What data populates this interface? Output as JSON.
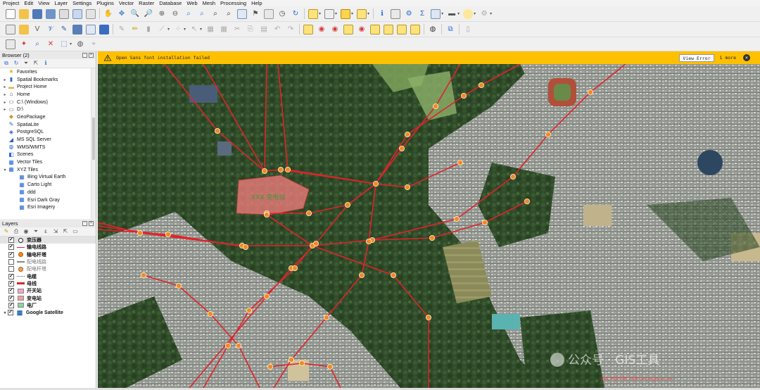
{
  "menu": [
    "Project",
    "Edit",
    "View",
    "Layer",
    "Settings",
    "Plugins",
    "Vector",
    "Raster",
    "Database",
    "Web",
    "Mesh",
    "Processing",
    "Help"
  ],
  "browser": {
    "title": "Browser (2)",
    "items": [
      {
        "label": "Favorites",
        "icon": "star-icon",
        "arrow": ""
      },
      {
        "label": "Spatial Bookmarks",
        "icon": "bookmark-icon",
        "arrow": "▸"
      },
      {
        "label": "Project Home",
        "icon": "folder-icon",
        "arrow": "▸"
      },
      {
        "label": "Home",
        "icon": "home-icon",
        "arrow": "▸"
      },
      {
        "label": "C:\\ (Windows)",
        "icon": "drive-icon",
        "arrow": "▸"
      },
      {
        "label": "D:\\",
        "icon": "drive-icon",
        "arrow": "▸"
      },
      {
        "label": "GeoPackage",
        "icon": "geopackage-icon",
        "arrow": ""
      },
      {
        "label": "SpatiaLite",
        "icon": "spatialite-icon",
        "arrow": ""
      },
      {
        "label": "PostgreSQL",
        "icon": "postgresql-icon",
        "arrow": ""
      },
      {
        "label": "MS SQL Server",
        "icon": "mssql-icon",
        "arrow": ""
      },
      {
        "label": "WMS/WMTS",
        "icon": "wms-icon",
        "arrow": ""
      },
      {
        "label": "Scenes",
        "icon": "scenes-icon",
        "arrow": ""
      },
      {
        "label": "Vector Tiles",
        "icon": "vector-tiles-icon",
        "arrow": ""
      },
      {
        "label": "XYZ Tiles",
        "icon": "xyz-tiles-icon",
        "arrow": "▾"
      },
      {
        "label": "Bing Virtual Earth",
        "icon": "grid-icon",
        "arrow": "",
        "indent": 1
      },
      {
        "label": "Carto Light",
        "icon": "grid-icon",
        "arrow": "",
        "indent": 1
      },
      {
        "label": "ddd",
        "icon": "grid-icon",
        "arrow": "",
        "indent": 1
      },
      {
        "label": "Esri Dark Gray",
        "icon": "grid-icon",
        "arrow": "",
        "indent": 1
      },
      {
        "label": "Esri Imagery",
        "icon": "grid-icon",
        "arrow": "",
        "indent": 1
      }
    ]
  },
  "layers": {
    "title": "Layers",
    "items": [
      {
        "label": "变压器",
        "checked": true,
        "symbol": "circle",
        "color": "#ffffff",
        "bold": true,
        "selected": true
      },
      {
        "label": "输电线路",
        "checked": true,
        "symbol": "line",
        "color": "#e0232a",
        "bold": true
      },
      {
        "label": "输电杆塔",
        "checked": true,
        "symbol": "dot",
        "color": "#f08a24",
        "bold": true
      },
      {
        "label": "配电线路",
        "checked": false,
        "symbol": "line",
        "color": "#888888",
        "dim": true
      },
      {
        "label": "配电杆塔",
        "checked": false,
        "symbol": "dot",
        "color": "#f2a65a",
        "dim": true
      },
      {
        "label": "电缆",
        "checked": true,
        "symbol": "dashed",
        "color": "#555555",
        "bold": true
      },
      {
        "label": "母线",
        "checked": true,
        "symbol": "thick",
        "color": "#d12a2a",
        "bold": true
      },
      {
        "label": "开关站",
        "checked": true,
        "symbol": "fill",
        "color": "#f2a7c4",
        "bold": true
      },
      {
        "label": "变电站",
        "checked": true,
        "symbol": "fill",
        "color": "#f0a1a1",
        "bold": true
      },
      {
        "label": "电厂",
        "checked": true,
        "symbol": "fill",
        "color": "#8fd19e",
        "bold": true
      },
      {
        "label": "Google Satellite",
        "checked": true,
        "symbol": "xyz",
        "color": "#2a6fb0",
        "bold": true,
        "group": true
      }
    ]
  },
  "message": {
    "text": "Open Sans font installation failed",
    "button": "View Error",
    "more": "1 more"
  },
  "map": {
    "line_color": "#e0232a",
    "tower_color": "#f08a24",
    "substation_color": "#f07c7c",
    "substation_label": "XXX 变电站",
    "watermark": "公众号 · GIS工具",
    "watermark_sub": "出品:不圈·不限 · 版权:Vinsuo@sina.com"
  },
  "colors": {
    "accent": "#ffc000"
  }
}
